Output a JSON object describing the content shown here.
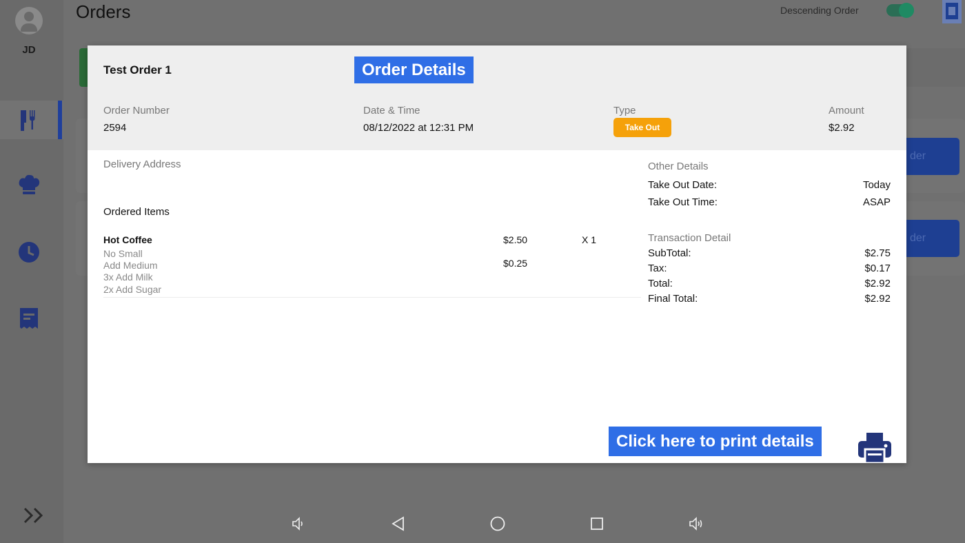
{
  "app": {
    "page_title": "Orders",
    "user_initials": "JD",
    "sort_label": "Descending Order",
    "sort_on": true,
    "bg_button_text": "der",
    "colors": {
      "primary": "#2f6ee6",
      "nav_blue": "#23357a",
      "take_out": "#f5a10a",
      "toggle": "#1f8a63"
    }
  },
  "sidebar": {
    "items": [
      {
        "icon": "utensils-icon",
        "active": true
      },
      {
        "icon": "chef-hat-icon",
        "active": false
      },
      {
        "icon": "clock-icon",
        "active": false
      },
      {
        "icon": "receipt-icon",
        "active": false
      }
    ],
    "expand_icon": "double-chevron-right-icon"
  },
  "modal": {
    "title": "Test Order 1",
    "callout_header": "Order Details",
    "callout_print": "Click here to print details",
    "order_number_label": "Order Number",
    "order_number": "2594",
    "datetime_label": "Date & Time",
    "datetime": "08/12/2022 at 12:31 PM",
    "type_label": "Type",
    "type": "Take Out",
    "amount_label": "Amount",
    "amount": "$2.92",
    "delivery_address_label": "Delivery Address",
    "ordered_items_label": "Ordered Items",
    "items": [
      {
        "name": "Hot Coffee",
        "price": "$2.50",
        "qty": "X  1",
        "modifiers": [
          {
            "text": "No Small",
            "price": ""
          },
          {
            "text": "Add Medium",
            "price": "$0.25"
          },
          {
            "text": "3x Add Milk",
            "price": ""
          },
          {
            "text": "2x Add Sugar",
            "price": ""
          }
        ]
      }
    ],
    "other_details_label": "Other Details",
    "other_details": [
      {
        "key": "Take Out Date:",
        "value": "Today"
      },
      {
        "key": "Take Out Time:",
        "value": "ASAP"
      }
    ],
    "transaction_label": "Transaction Detail",
    "transaction": [
      {
        "key": "SubTotal:",
        "value": "$2.75"
      },
      {
        "key": "Tax:",
        "value": "$0.17"
      },
      {
        "key": "Total:",
        "value": "$2.92"
      },
      {
        "key": "Final Total:",
        "value": "$2.92"
      }
    ],
    "print_icon": "printer-icon"
  },
  "system_bar": [
    "volume-down-icon",
    "back-icon",
    "home-icon",
    "recents-icon",
    "volume-up-icon"
  ]
}
